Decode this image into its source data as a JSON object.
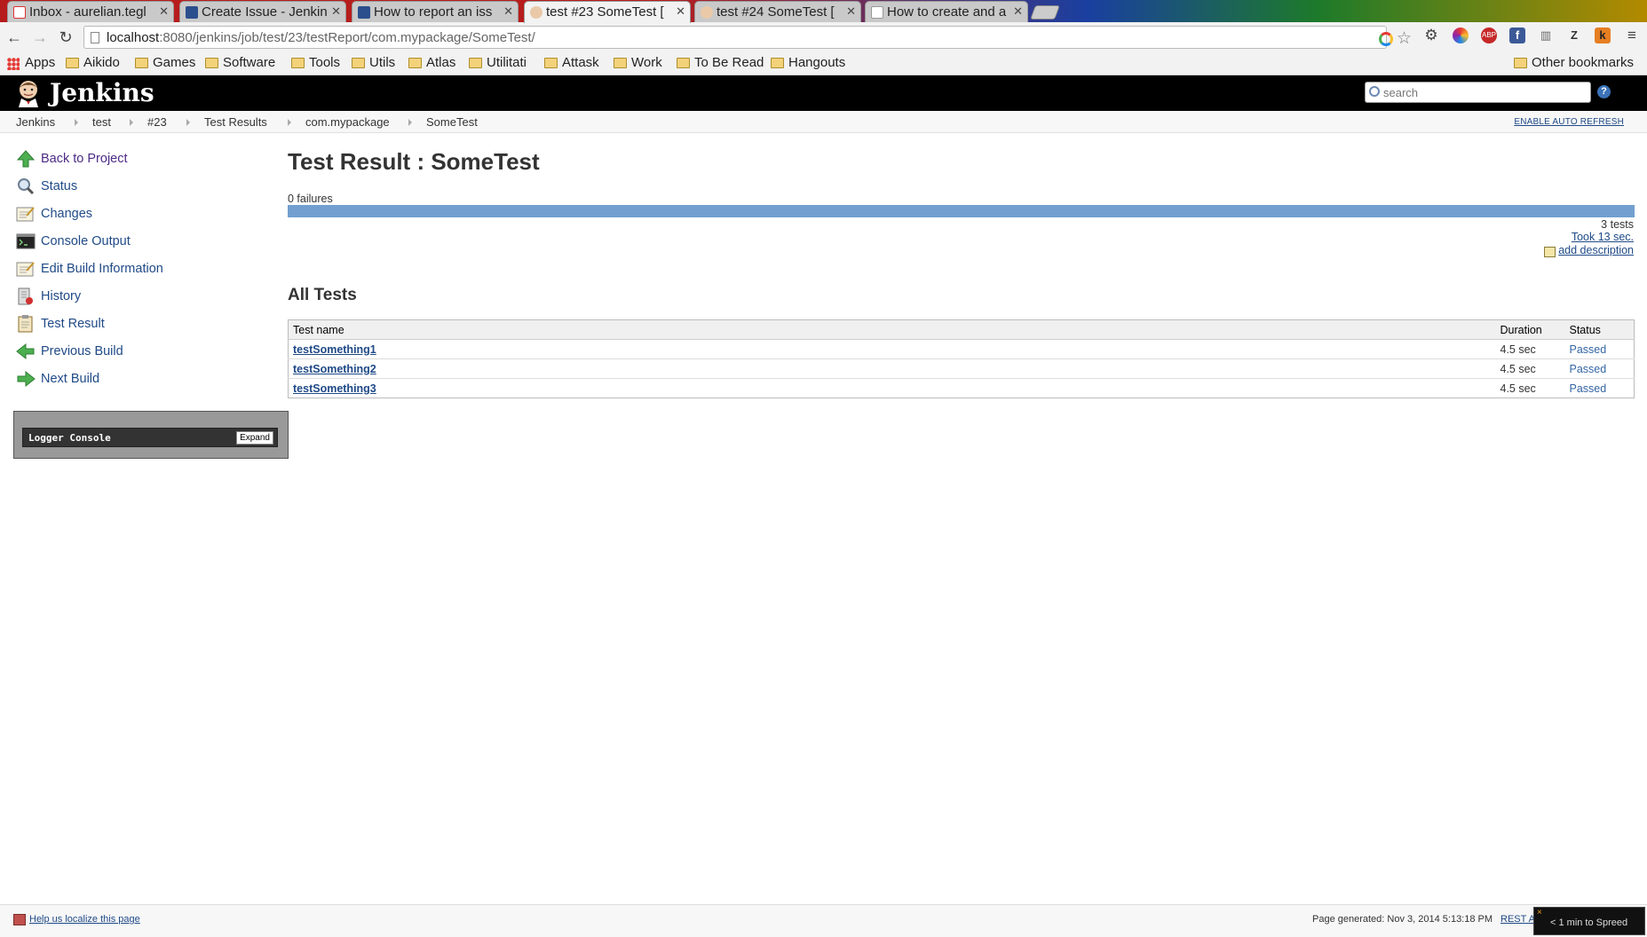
{
  "browser": {
    "tabs": [
      {
        "title": "Inbox - aurelian.tegl",
        "active": false
      },
      {
        "title": "Create Issue - Jenkin",
        "active": false
      },
      {
        "title": "How to report an iss",
        "active": false
      },
      {
        "title": "test #23 SomeTest [",
        "active": true
      },
      {
        "title": "test #24 SomeTest [",
        "active": false
      },
      {
        "title": "How to create and a",
        "active": false
      }
    ],
    "url_host": "localhost",
    "url_rest": ":8080/jenkins/job/test/23/testReport/com.mypackage/SomeTest/",
    "bookmarks": [
      "Apps",
      "Aikido",
      "Games",
      "Software",
      "Tools",
      "Utils",
      "Atlas",
      "Utilitati",
      "Attask",
      "Work",
      "To Be Read",
      "Hangouts"
    ],
    "other_bookmarks": "Other bookmarks"
  },
  "jenkins": {
    "title": "Jenkins",
    "search_placeholder": "search",
    "help": "?"
  },
  "breadcrumb": [
    "Jenkins",
    "test",
    "#23",
    "Test Results",
    "com.mypackage",
    "SomeTest"
  ],
  "auto_refresh": "ENABLE AUTO REFRESH",
  "sidebar": [
    {
      "label": "Back to Project",
      "icon": "up-arrow-icon"
    },
    {
      "label": "Status",
      "icon": "magnifier-icon"
    },
    {
      "label": "Changes",
      "icon": "notepad-icon"
    },
    {
      "label": "Console Output",
      "icon": "terminal-icon"
    },
    {
      "label": "Edit Build Information",
      "icon": "notepad-icon"
    },
    {
      "label": "History",
      "icon": "history-icon"
    },
    {
      "label": "Test Result",
      "icon": "clipboard-icon"
    },
    {
      "label": "Previous Build",
      "icon": "left-arrow-icon"
    },
    {
      "label": "Next Build",
      "icon": "right-arrow-icon"
    }
  ],
  "logger": {
    "label": "Logger Console",
    "expand": "Expand"
  },
  "main": {
    "title": "Test Result : SomeTest",
    "failures": "0 failures",
    "pass_fraction": 1.0,
    "tests_count": "3 tests",
    "took": "Took 13 sec.",
    "add_description": "add description",
    "all_tests_heading": "All Tests",
    "table": {
      "headers": [
        "Test name",
        "Duration",
        "Status"
      ],
      "rows": [
        [
          "testSomething1",
          "4.5 sec",
          "Passed"
        ],
        [
          "testSomething2",
          "4.5 sec",
          "Passed"
        ],
        [
          "testSomething3",
          "4.5 sec",
          "Passed"
        ]
      ]
    }
  },
  "footer": {
    "localize": "Help us localize this page",
    "generated": "Page generated: Nov 3, 2014 5:13:18 PM",
    "rest": "REST A"
  },
  "toast": {
    "text": "< 1 min to Spreed",
    "close": "×"
  },
  "colors": {
    "jenkins_link": "#204a87",
    "progress_pass": "#729fcf",
    "header_bg": "#000000"
  }
}
